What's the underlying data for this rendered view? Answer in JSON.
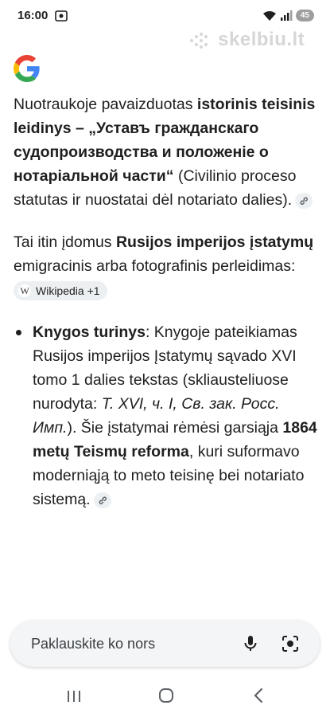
{
  "status_bar": {
    "time": "16:00",
    "battery": "45"
  },
  "watermark": {
    "text": "skelbiu.lt"
  },
  "answer": {
    "p1": {
      "t1": "Nuotraukoje pavaizduotas ",
      "b1": "istorinis teisinis leidinys – „Уставъ гражданскаго судопроизводства и положеніе о нотаріальной части“",
      "t2": " (Civilinio proceso statutas ir nuostatai dėl notariato dalies)."
    },
    "p2": {
      "t1": "Tai itin įdomus ",
      "b1": "Rusijos imperijos įstatymų",
      "t2": " emigracinis arba fotografinis perleidimas: ",
      "source_chip": "Wikipedia +1"
    },
    "bullet1": {
      "b1": "Knygos turinys",
      "t1": ": Knygoje pateikiamas Rusijos imperijos Įstatymų sąvado XVI tomo 1 dalies tekstas (skliausteliuose nurodyta: ",
      "i1": "Т. XVI, ч. I, Св. зак. Росс. Имп.",
      "t2": "). Šie įstatymai rėmėsi garsiąja ",
      "b2": "1864 metų Teismų reforma",
      "t3": ", kuri suformavo moderniąją to meto teisinę bei notariato sistemą."
    }
  },
  "ask_bar": {
    "placeholder": "Paklauskite ko nors"
  },
  "icons": {
    "google": "google-logo",
    "mic": "mic-icon",
    "lens": "lens-icon",
    "link": "link-icon",
    "wikipedia": "wikipedia-icon"
  },
  "colors": {
    "google_blue": "#4285F4",
    "google_red": "#EA4335",
    "google_yellow": "#FBBC05",
    "google_green": "#34A853",
    "chip_bg": "#edf0f2"
  }
}
